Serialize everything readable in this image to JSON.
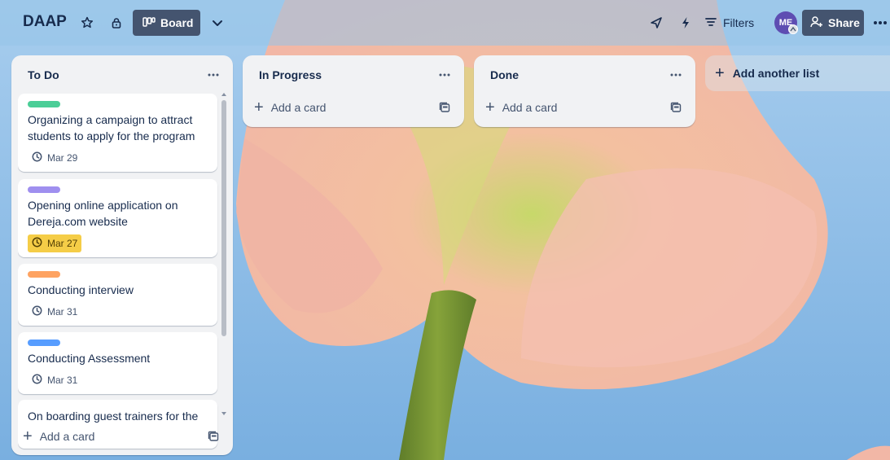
{
  "board": {
    "title": "DAAP",
    "view_label": "Board",
    "filters_label": "Filters",
    "avatar_initials": "ME",
    "share_label": "Share"
  },
  "lists": [
    {
      "title": "To Do",
      "add_card_label": "Add a card",
      "cards": [
        {
          "label_color": "#4bce97",
          "title": "Organizing a campaign to attract students to apply for the program",
          "due": "Mar 29",
          "due_status": "normal"
        },
        {
          "label_color": "#9f8fef",
          "title": "Opening online application on Dereja.com website",
          "due": "Mar 27",
          "due_status": "due-soon"
        },
        {
          "label_color": "#fea362",
          "title": "Conducting interview",
          "due": "Mar 31",
          "due_status": "normal"
        },
        {
          "label_color": "#579dff",
          "title": "Conducting Assessment",
          "due": "Mar 31",
          "due_status": "normal"
        },
        {
          "label_color": "",
          "title": "On boarding guest trainers for the",
          "due": "",
          "due_status": ""
        }
      ]
    },
    {
      "title": "In Progress",
      "add_card_label": "Add a card",
      "cards": []
    },
    {
      "title": "Done",
      "add_card_label": "Add a card",
      "cards": []
    }
  ],
  "add_list_label": "Add another list",
  "colors": {
    "header_button": "#44546f",
    "avatar": "#5e4db2",
    "due_soon": "#f5cd47"
  },
  "icons": [
    "star-icon",
    "lock-icon",
    "board-icon",
    "chevron-down-icon",
    "send-icon",
    "lightning-icon",
    "filter-icon",
    "add-person-icon",
    "more-icon",
    "clock-icon",
    "template-icon"
  ]
}
